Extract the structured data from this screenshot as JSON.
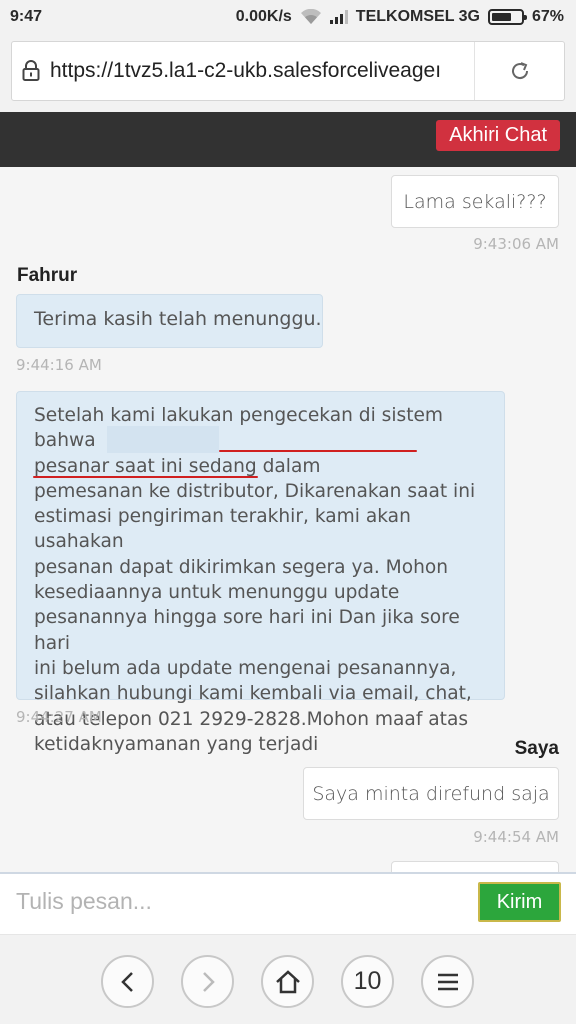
{
  "status": {
    "time": "9:47",
    "speed": "0.00K/s",
    "carrier": "TELKOMSEL 3G",
    "battery": "67%",
    "battery_level": 0.67
  },
  "browser": {
    "url": "https://1tvz5.la1-c2-ukb.salesforceliveageı"
  },
  "chat": {
    "end_button": "Akhiri Chat",
    "messages": [
      {
        "sender": "",
        "text": "Lama sekali???",
        "time": "9:43:06 AM"
      },
      {
        "sender": "Fahrur",
        "text": "Terima kasih telah menunggu.",
        "time": "9:44:16 AM"
      },
      {
        "sender": "",
        "text": "Setelah kami lakukan pengecekan di sistem bahwa\npesanar                saat ini sedang dalam\npemesanan ke distributor, Dikarenakan saat ini\nestimasi pengiriman terakhir, kami akan usahakan\npesanan dapat dikirimkan segera ya. Mohon\nkesediaannya untuk menunggu update\npesanannya hingga sore hari ini Dan jika sore hari\nini belum ada update mengenai pesanannya,\nsilahkan hubungi kami kembali via email, chat,\natau telepon 021 2929-2828.Mohon maaf atas\nketidaknyamanan yang terjadi",
        "time": "9:44:27 AM"
      },
      {
        "sender": "Saya",
        "text": "Saya minta direfund saja",
        "time": "9:44:54 AM"
      }
    ]
  },
  "input": {
    "placeholder": "Tulis pesan...",
    "send_label": "Kirim"
  },
  "nav": {
    "tabs_count": "10"
  },
  "colors": {
    "header_bg": "#323232",
    "end_button": "#d1313f",
    "send_button": "#2ca63c",
    "agent_bubble": "#deebf5"
  }
}
